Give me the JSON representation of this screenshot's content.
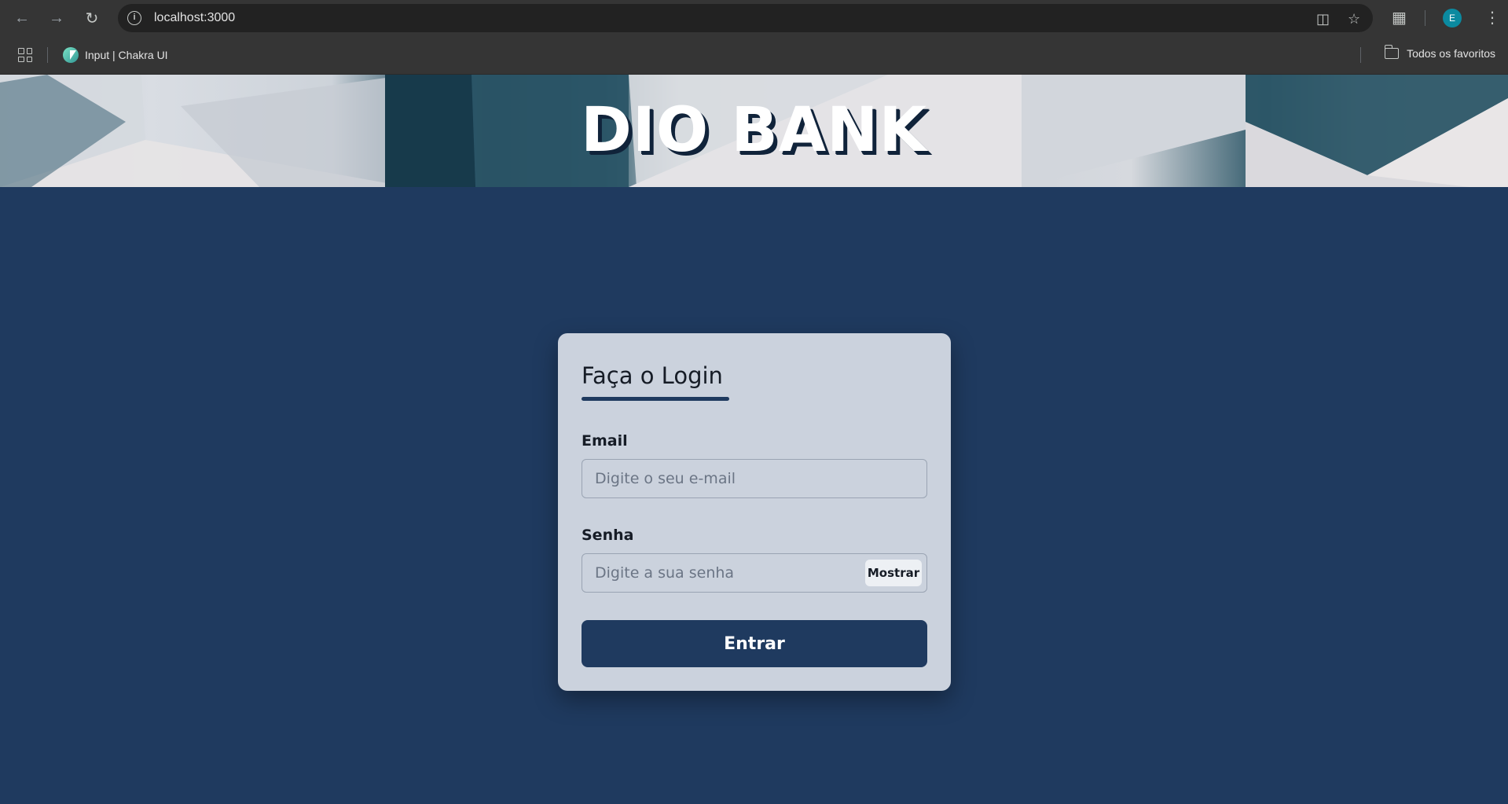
{
  "browser": {
    "url": "localhost:3000",
    "bookmarks": [
      {
        "label": "Input | Chakra UI",
        "icon": "chakra-ui-logo"
      }
    ],
    "favorites_label": "Todos os favoritos",
    "profile_initial": "E"
  },
  "banner": {
    "title": "DIO BANK"
  },
  "login": {
    "title": "Faça o Login",
    "email_label": "Email",
    "email_placeholder": "Digite o seu e-mail",
    "password_label": "Senha",
    "password_placeholder": "Digite a sua senha",
    "show_label": "Mostrar",
    "submit_label": "Entrar"
  },
  "colors": {
    "page_background": "#1f3a5f",
    "card_background": "#cbd2dd",
    "primary": "#1f3a5f"
  }
}
